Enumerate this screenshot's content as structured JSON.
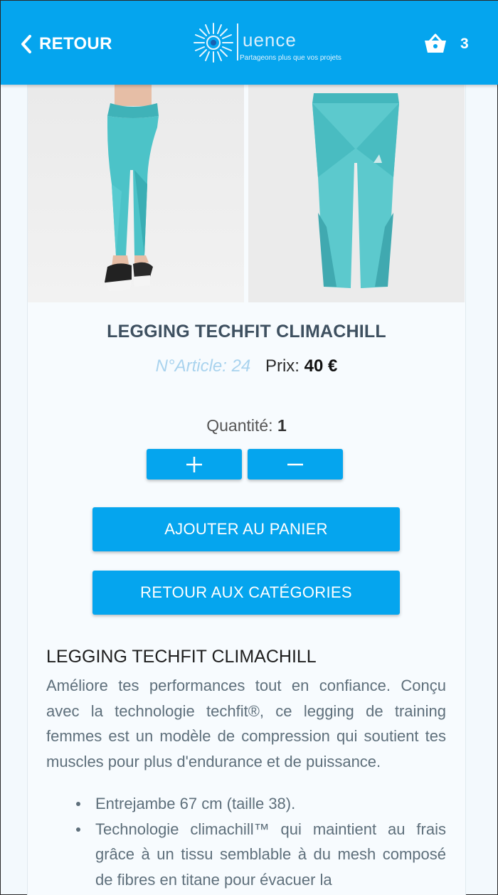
{
  "header": {
    "back_label": "RETOUR",
    "logo_word": "uence",
    "logo_tagline": "Partageons plus que vos projets",
    "cart_count": "3"
  },
  "product": {
    "title": "LEGGING TECHFIT CLIMACHILL",
    "article_label": "N°Article: 24",
    "price_label": "Prix:",
    "price_value": "40 €",
    "quantity_label": "Quantité:",
    "quantity_value": "1"
  },
  "actions": {
    "add_to_cart": "AJOUTER AU PANIER",
    "back_to_categories": "RETOUR AUX CATÉGORIES"
  },
  "description": {
    "heading": "LEGGING TECHFIT CLIMACHILL",
    "text": "Améliore tes performances tout en confiance. Conçu avec la technologie techfit®, ce legging de training femmes est un modèle de compression qui soutient tes muscles pour plus d'endurance et de puissance.",
    "bullets": [
      "Entrejambe 67 cm (taille 38).",
      "Technologie climachill™ qui maintient au frais grâce à un tissu semblable à du mesh composé de fibres en titane pour évacuer la"
    ]
  },
  "colors": {
    "accent": "#05a5ee",
    "legging": "#4cc3c8",
    "page_bg": "#f3f9fd"
  },
  "icons": [
    "chevron-left-icon",
    "basket-icon",
    "plus-icon",
    "minus-icon"
  ]
}
